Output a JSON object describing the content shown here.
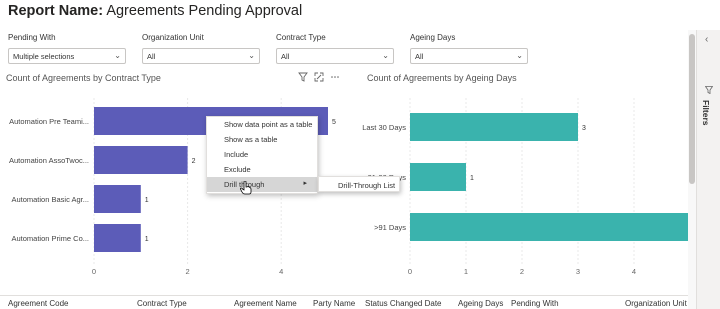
{
  "header": {
    "label": "Report Name:",
    "title": "Agreements Pending Approval"
  },
  "slicers": [
    {
      "label": "Pending With",
      "value": "Multiple selections"
    },
    {
      "label": "Organization Unit",
      "value": "All"
    },
    {
      "label": "Contract Type",
      "value": "All"
    },
    {
      "label": "Ageing Days",
      "value": "All"
    }
  ],
  "filters_pane": {
    "label": "Filters",
    "collapse_icon": "chevron-left-icon",
    "filter_icon": "funnel-icon"
  },
  "visual_icons": [
    "filter-icon",
    "focus-mode-icon",
    "more-options-icon"
  ],
  "context_menu": {
    "items": [
      "Show data point as a table",
      "Show as a table",
      "Include",
      "Exclude",
      "Drill through"
    ],
    "active_item": "Drill through",
    "submenu": "Drill-Through List"
  },
  "table_header": [
    "Agreement Code",
    "Contract Type",
    "Agreement Name",
    "Party Name",
    "Status Changed Date",
    "Ageing Days",
    "Pending With",
    "Organization Unit"
  ],
  "chart_data": [
    {
      "type": "bar",
      "orientation": "horizontal",
      "title": "Count of Agreements by Contract Type",
      "categories": [
        "Automation Pre Teami...",
        "Automation AssoTwoc...",
        "Automation Basic Agr...",
        "Automation Prime Co..."
      ],
      "values": [
        5,
        2,
        1,
        1
      ],
      "xlim": [
        0,
        5
      ],
      "xticks": [
        "0",
        "2",
        "4"
      ],
      "color": "#5c5cb8",
      "grid": true
    },
    {
      "type": "bar",
      "orientation": "horizontal",
      "title": "Count of Agreements by Ageing Days",
      "categories": [
        "Last 30 Days",
        "31-90 Days",
        ">91 Days"
      ],
      "values": [
        3,
        1,
        5
      ],
      "xlim": [
        0,
        5
      ],
      "xticks": [
        "0",
        "1",
        "2",
        "3",
        "4",
        "5"
      ],
      "color": "#3ab3ad",
      "grid": true
    }
  ]
}
